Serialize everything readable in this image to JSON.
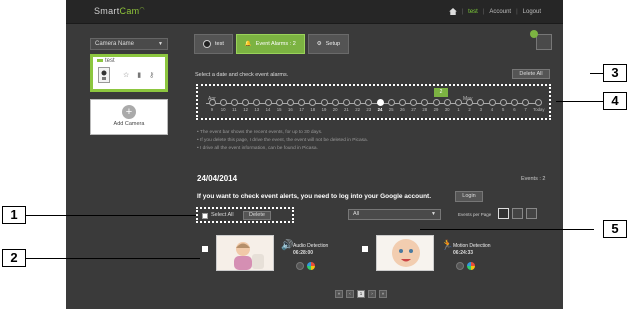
{
  "header": {
    "logo_main": "Smart",
    "logo_accent": "Cam",
    "user": "test",
    "sep1": "|",
    "account": "Account",
    "sep2": "|",
    "logout": "Logout"
  },
  "sidebar": {
    "camera_select": "Camera Name",
    "camera_name": "test",
    "add_camera": "Add Camera"
  },
  "tabs": [
    {
      "label": "test"
    },
    {
      "label": "Event Alarms : 2"
    },
    {
      "label": "Setup"
    }
  ],
  "timeline": {
    "instruction": "Select a date and check event alarms.",
    "delete_all": "Delete All",
    "months": [
      "Apr",
      "May"
    ],
    "days": [
      "9",
      "10",
      "11",
      "12",
      "13",
      "14",
      "15",
      "16",
      "17",
      "18",
      "19",
      "20",
      "21",
      "22",
      "23",
      "24",
      "25",
      "26",
      "27",
      "28",
      "29",
      "30",
      "1",
      "2",
      "3",
      "4",
      "5",
      "6",
      "7",
      "Today"
    ],
    "selected_day": "24",
    "selected_count": "2"
  },
  "notes": [
    "• The event bar shows the recent events, for up to 30 days.",
    "• If you delete this page, I drive the event, the event will not be deleted in Picasa.",
    "• I drive all the event information, can be found in Picasa."
  ],
  "date": "24/04/2014",
  "events_count": "Events : 2",
  "google_prompt": "If you want to check event alerts, you need to log into your Google account.",
  "login_button": "Login",
  "controls": {
    "select_all": "Select All",
    "delete": "Delete",
    "filter_value": "All",
    "events_per_page": "Events per Page"
  },
  "events": [
    {
      "type": "Audio Detection",
      "time": "06:28:00",
      "icon": "speaker-icon"
    },
    {
      "type": "Motion Detection",
      "time": "06:24:33",
      "icon": "running-person-icon"
    }
  ],
  "pager": [
    "«",
    "‹",
    "1",
    "›",
    "»"
  ],
  "callouts": [
    "1",
    "2",
    "3",
    "4",
    "5"
  ],
  "colors": {
    "accent": "#7cb342",
    "background": "#3a3a3a",
    "topbar": "#262626"
  }
}
